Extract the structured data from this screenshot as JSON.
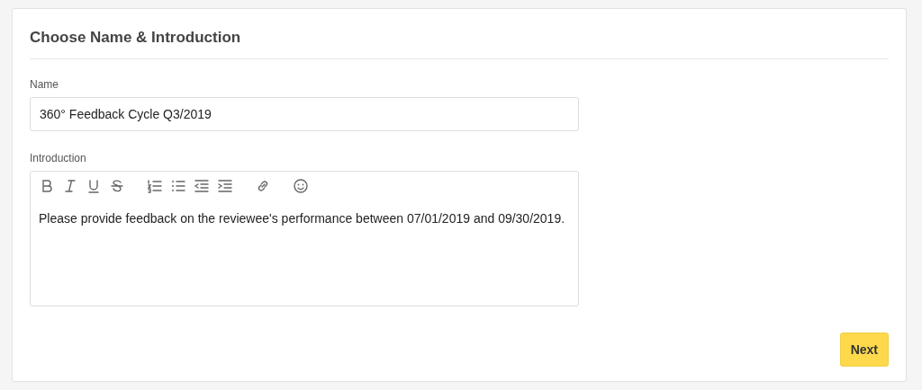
{
  "card": {
    "title": "Choose Name & Introduction"
  },
  "name_field": {
    "label": "Name",
    "value": "360° Feedback Cycle Q3/2019"
  },
  "introduction": {
    "label": "Introduction",
    "toolbar": [
      {
        "kind": "bold"
      },
      {
        "kind": "italic"
      },
      {
        "kind": "underline"
      },
      {
        "kind": "strike"
      },
      {
        "kind": "ordered-list"
      },
      {
        "kind": "bullet-list"
      },
      {
        "kind": "outdent"
      },
      {
        "kind": "indent"
      },
      {
        "kind": "link"
      },
      {
        "kind": "emoji"
      }
    ],
    "text": "Please provide feedback on the reviewee's performance between 07/01/2019 and 09/30/2019."
  },
  "buttons": [
    {
      "label": "Next"
    }
  ]
}
